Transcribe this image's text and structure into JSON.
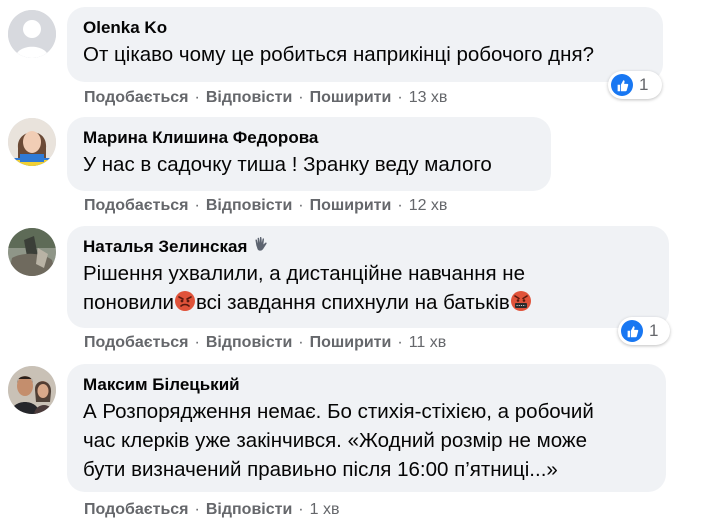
{
  "comments": [
    {
      "author": "Olenka Ko",
      "text": "От цікаво чому це робиться наприкінці робочого дня?",
      "actions": {
        "like": "Подобається",
        "reply": "Відповісти",
        "share": "Поширити",
        "time": "13 хв"
      },
      "reaction": {
        "icon": "like-icon",
        "count": "1"
      }
    },
    {
      "author": "Марина Клишина Федорова",
      "text": "У нас в садочку тиша ! Зранку веду малого",
      "actions": {
        "like": "Подобається",
        "reply": "Відповісти",
        "share": "Поширити",
        "time": "12 хв"
      }
    },
    {
      "author": "Наталья Зелинская",
      "author_badge_icon": "waving-hand-icon",
      "text_lines": [
        "Рішення ухвалили, а дистанційне навчання не",
        "поновили",
        "всі завдання спихнули на батьків"
      ],
      "emojis": [
        "angry-face-icon",
        "cursing-face-icon"
      ],
      "actions": {
        "like": "Подобається",
        "reply": "Відповісти",
        "share": "Поширити",
        "time": "11 хв"
      },
      "reaction": {
        "icon": "like-icon",
        "count": "1"
      }
    },
    {
      "author": "Максим Білецький",
      "text_lines": [
        "А Розпорядження немає. Бо стихія-стіхією, а робочий",
        "час клерків уже закінчився. «Жодний розмір не може",
        "бути визначений правиьно після 16:00 п’ятниці...»"
      ],
      "actions": {
        "like": "Подобається",
        "reply": "Відповісти",
        "time": "1 хв"
      }
    }
  ],
  "colors": {
    "bubble": "#f0f2f5",
    "meta": "#65676b",
    "like_blue": "#1877f2",
    "text": "#050505"
  }
}
